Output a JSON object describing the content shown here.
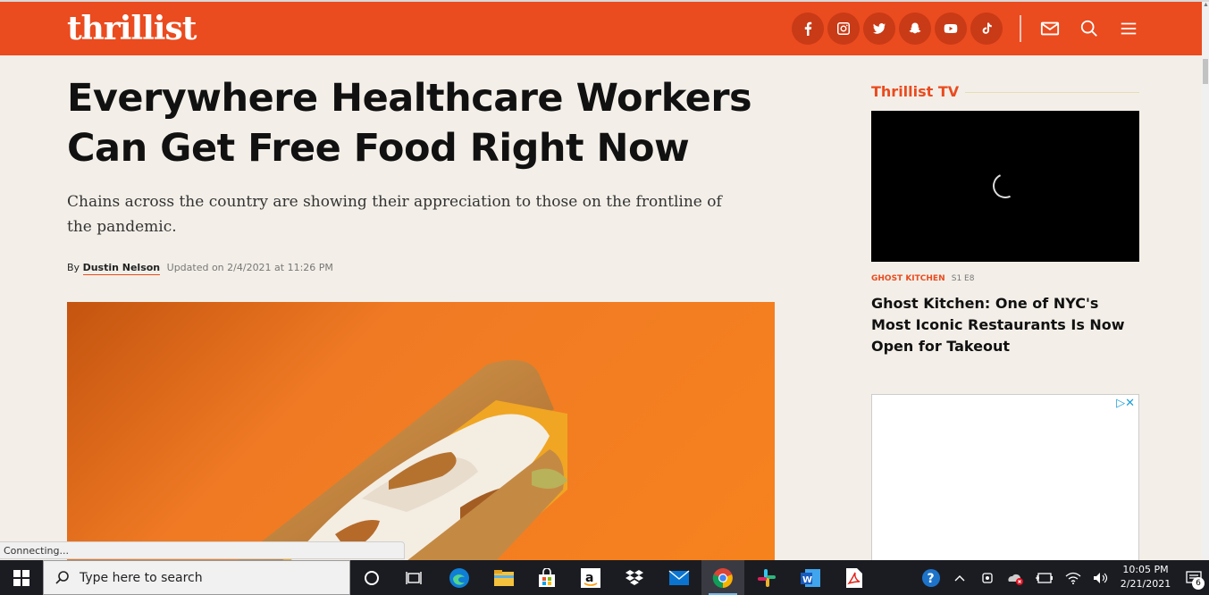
{
  "header": {
    "logo": "thrillist",
    "social": [
      "facebook-icon",
      "instagram-icon",
      "twitter-icon",
      "snapchat-icon",
      "youtube-icon",
      "tiktok-icon"
    ],
    "actions": [
      "mail-icon",
      "search-icon",
      "menu-icon"
    ],
    "brand_color": "#ea4b1f"
  },
  "article": {
    "headline": "Everywhere Healthcare Workers Can Get Free Food Right Now",
    "dek": "Chains across the country are showing their appreciation to those on the frontline of the pandemic.",
    "byline_prefix": "By",
    "author": "Dustin Nelson",
    "updated": "Updated on 2/4/2021 at 11:26 PM"
  },
  "sidebar": {
    "section_title": "Thrillist TV",
    "video": {
      "show": "GHOST KITCHEN",
      "episode": "S1 E8",
      "title": "Ghost Kitchen: One of NYC's Most Iconic Restaurants Is Now Open for Takeout"
    }
  },
  "browser": {
    "status_text": "Connecting..."
  },
  "taskbar": {
    "search_placeholder": "Type here to search",
    "apps": [
      "cortana-icon",
      "task-view-icon",
      "edge-icon",
      "file-explorer-icon",
      "store-icon",
      "amazon-icon",
      "dropbox-icon",
      "mail-icon",
      "chrome-icon",
      "slack-icon",
      "word-icon",
      "pdf-icon"
    ],
    "time": "10:05 PM",
    "date": "2/21/2021",
    "notification_count": "6"
  }
}
